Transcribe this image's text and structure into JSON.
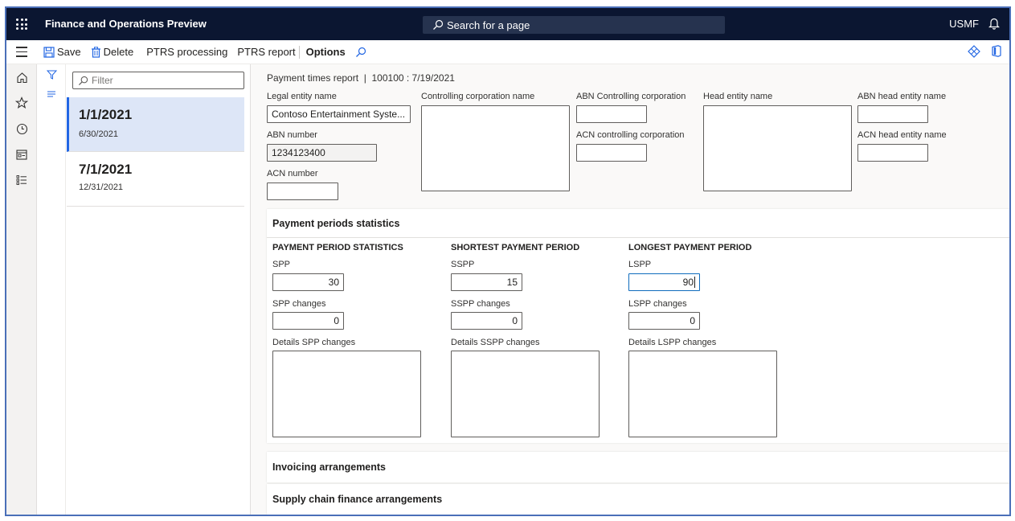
{
  "topbar": {
    "app_title": "Finance and Operations Preview",
    "search_placeholder": "Search for a page",
    "company": "USMF"
  },
  "actions": {
    "save": "Save",
    "delete": "Delete",
    "ptrs_processing": "PTRS processing",
    "ptrs_report": "PTRS report",
    "options": "Options"
  },
  "filter": {
    "placeholder": "Filter"
  },
  "list": [
    {
      "title": "1/1/2021",
      "sub": "6/30/2021",
      "selected": true
    },
    {
      "title": "7/1/2021",
      "sub": "12/31/2021",
      "selected": false
    }
  ],
  "header": {
    "caption": "Payment times report  |  100100 : 7/19/2021",
    "legal_entity_label": "Legal entity name",
    "legal_entity_value": "Contoso Entertainment Syste...",
    "abn_number_label": "ABN number",
    "abn_number_value": "1234123400",
    "acn_number_label": "ACN number",
    "acn_number_value": "",
    "controlling_corp_label": "Controlling corporation name",
    "abn_controlling_label": "ABN Controlling corporation",
    "acn_controlling_label": "ACN controlling corporation",
    "head_entity_label": "Head entity name",
    "abn_head_label": "ABN head entity name",
    "acn_head_label": "ACN head entity name"
  },
  "stats": {
    "section_title": "Payment periods statistics",
    "groups": [
      {
        "title": "PAYMENT PERIOD STATISTICS",
        "field_label": "SPP",
        "field_value": "30",
        "changes_label": "SPP changes",
        "changes_value": "0",
        "details_label": "Details SPP changes"
      },
      {
        "title": "SHORTEST PAYMENT PERIOD",
        "field_label": "SSPP",
        "field_value": "15",
        "changes_label": "SSPP changes",
        "changes_value": "0",
        "details_label": "Details SSPP changes"
      },
      {
        "title": "LONGEST PAYMENT PERIOD",
        "field_label": "LSPP",
        "field_value": "90",
        "changes_label": "LSPP changes",
        "changes_value": "0",
        "details_label": "Details LSPP changes"
      }
    ]
  },
  "sections": {
    "invoicing": "Invoicing arrangements",
    "supply_chain": "Supply chain finance arrangements"
  },
  "colors": {
    "topbar_bg": "#0b1631",
    "accent": "#2266e3",
    "selected_item_bg": "#dde6f7"
  }
}
